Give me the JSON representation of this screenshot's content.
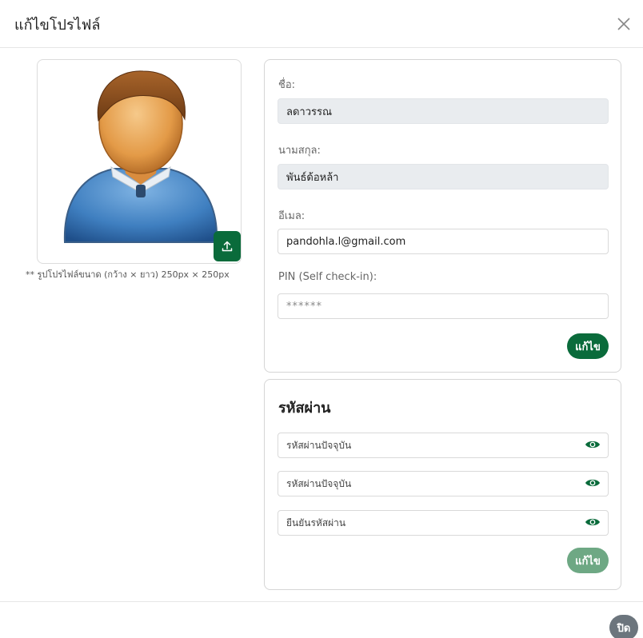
{
  "header": {
    "title": "แก้ไขโปรไฟล์"
  },
  "avatar": {
    "note": "** รูปโปรไฟล์ขนาด (กว้าง × ยาว) 250px × 250px"
  },
  "profile": {
    "first_name_label": "ชื่อ:",
    "first_name_value": "ลดาวรรณ",
    "last_name_label": "นามสกุล:",
    "last_name_value": "พันธ์ด้อหล้า",
    "email_label": "อีเมล:",
    "email_value": "pandohla.l@gmail.com",
    "pin_label": "PIN (Self check-in):",
    "pin_value": "******",
    "save_label": "แก้ไข"
  },
  "password": {
    "title": "รหัสผ่าน",
    "current_placeholder": "รหัสผ่านปัจจุบัน",
    "new_placeholder": "รหัสผ่านปัจจุบัน",
    "confirm_placeholder": "ยืนยันรหัสผ่าน",
    "save_label": "แก้ไข"
  },
  "footer": {
    "close_label": "ปิด"
  },
  "colors": {
    "primary": "#0a6b3b",
    "primary_disabled": "#6ea884",
    "secondary": "#6c757d"
  }
}
